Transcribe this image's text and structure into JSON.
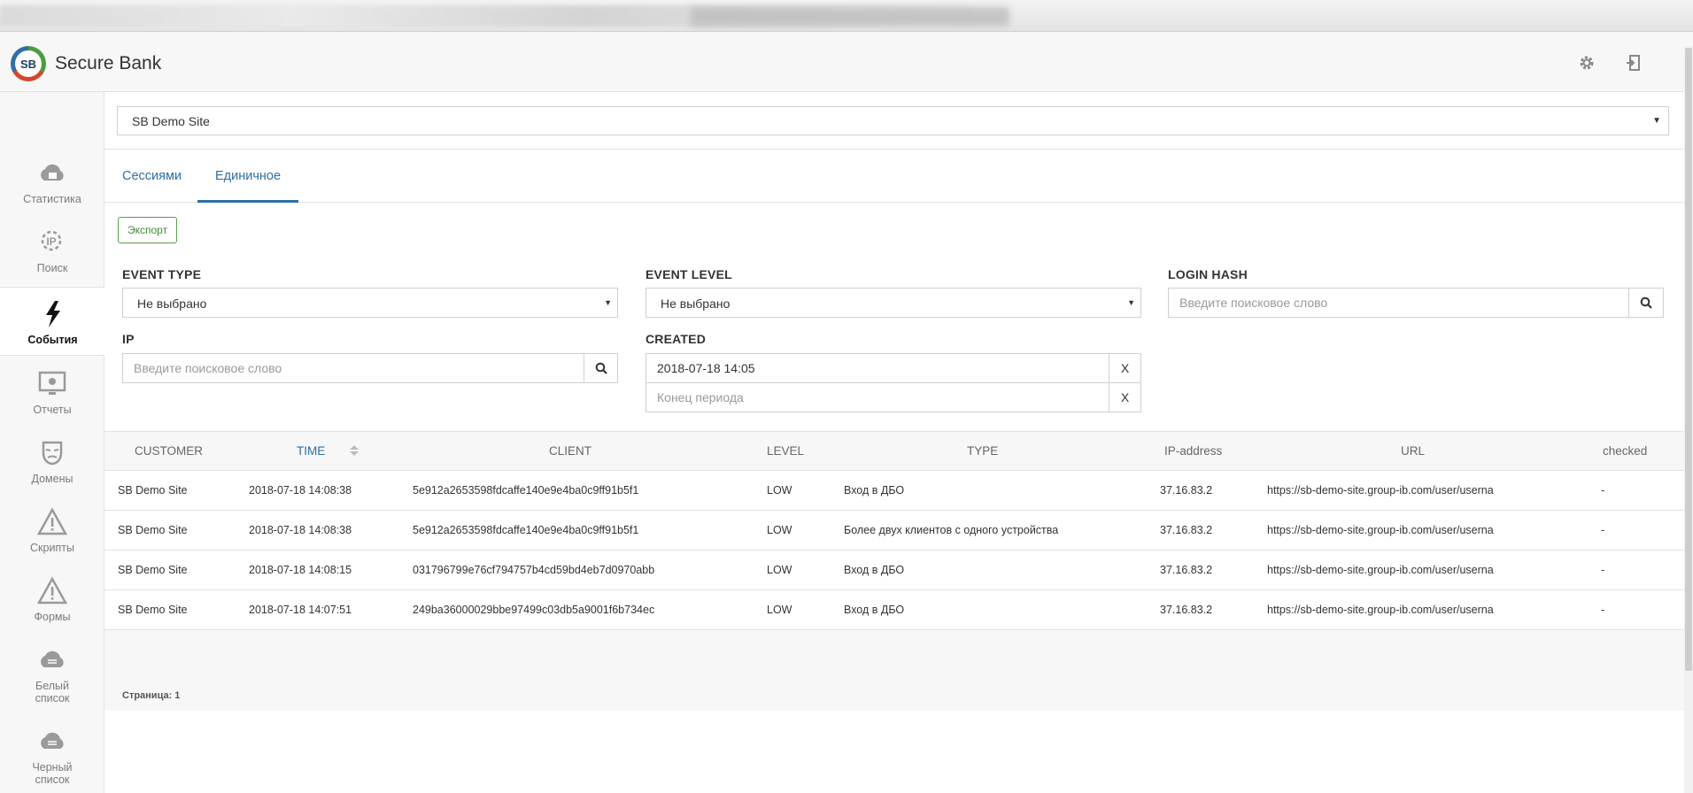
{
  "app": {
    "brand": "Secure Bank",
    "logo_text": "SB"
  },
  "header_icons": [
    "gear-icon",
    "logout-icon"
  ],
  "site_select": {
    "value": "SB Demo Site"
  },
  "sidebar": {
    "items": [
      {
        "label": "Статистика",
        "icon": "cloud-stats-icon"
      },
      {
        "label": "Поиск",
        "icon": "ip-search-icon"
      },
      {
        "label": "События",
        "icon": "lightning-icon",
        "active": true
      },
      {
        "label": "Отчеты",
        "icon": "monitor-bug-icon"
      },
      {
        "label": "Домены",
        "icon": "mask-icon"
      },
      {
        "label": "Скрипты",
        "icon": "warning-icon"
      },
      {
        "label": "Формы",
        "icon": "warning-icon"
      },
      {
        "label": "Белый список",
        "icon": "cloud-list-icon"
      },
      {
        "label": "Черный список",
        "icon": "cloud-list-icon"
      }
    ]
  },
  "tabs": [
    {
      "label": "Сессиями"
    },
    {
      "label": "Единичное",
      "active": true
    }
  ],
  "toolbar": {
    "export_label": "Экспорт"
  },
  "filters": {
    "event_type": {
      "label": "EVENT TYPE",
      "value": "Не выбрано"
    },
    "event_level": {
      "label": "EVENT LEVEL",
      "value": "Не выбрано"
    },
    "login_hash": {
      "label": "LOGIN HASH",
      "placeholder": "Введите поисковое слово",
      "value": ""
    },
    "ip": {
      "label": "IP",
      "placeholder": "Введите поисковое слово",
      "value": ""
    },
    "created": {
      "label": "CREATED",
      "start_value": "2018-07-18 14:05",
      "end_placeholder": "Конец периода",
      "clear_label": "X"
    }
  },
  "table": {
    "columns": [
      "CUSTOMER",
      "TIME",
      "CLIENT",
      "LEVEL",
      "TYPE",
      "IP-address",
      "URL",
      "checked"
    ],
    "sorted_column": "TIME",
    "rows": [
      [
        "SB Demo Site",
        "2018-07-18 14:08:38",
        "5e912a2653598fdcaffe140e9e4ba0c9ff91b5f1",
        "LOW",
        "Вход в ДБО",
        "37.16.83.2",
        "https://sb-demo-site.group-ib.com/user/userna",
        "-"
      ],
      [
        "SB Demo Site",
        "2018-07-18 14:08:38",
        "5e912a2653598fdcaffe140e9e4ba0c9ff91b5f1",
        "LOW",
        "Более двух клиентов с одного устройства",
        "37.16.83.2",
        "https://sb-demo-site.group-ib.com/user/userna",
        "-"
      ],
      [
        "SB Demo Site",
        "2018-07-18 14:08:15",
        "031796799e76cf794757b4cd59bd4eb7d0970abb",
        "LOW",
        "Вход в ДБО",
        "37.16.83.2",
        "https://sb-demo-site.group-ib.com/user/userna",
        "-"
      ],
      [
        "SB Demo Site",
        "2018-07-18 14:07:51",
        "249ba36000029bbe97499c03db5a9001f6b734ec",
        "LOW",
        "Вход в ДБО",
        "37.16.83.2",
        "https://sb-demo-site.group-ib.com/user/userna",
        "-"
      ]
    ],
    "pager": "Страница: 1"
  },
  "colors": {
    "accent": "#2d6ea3",
    "export_green": "#3e8a33",
    "sidebar_bg": "#f7f7f7"
  }
}
